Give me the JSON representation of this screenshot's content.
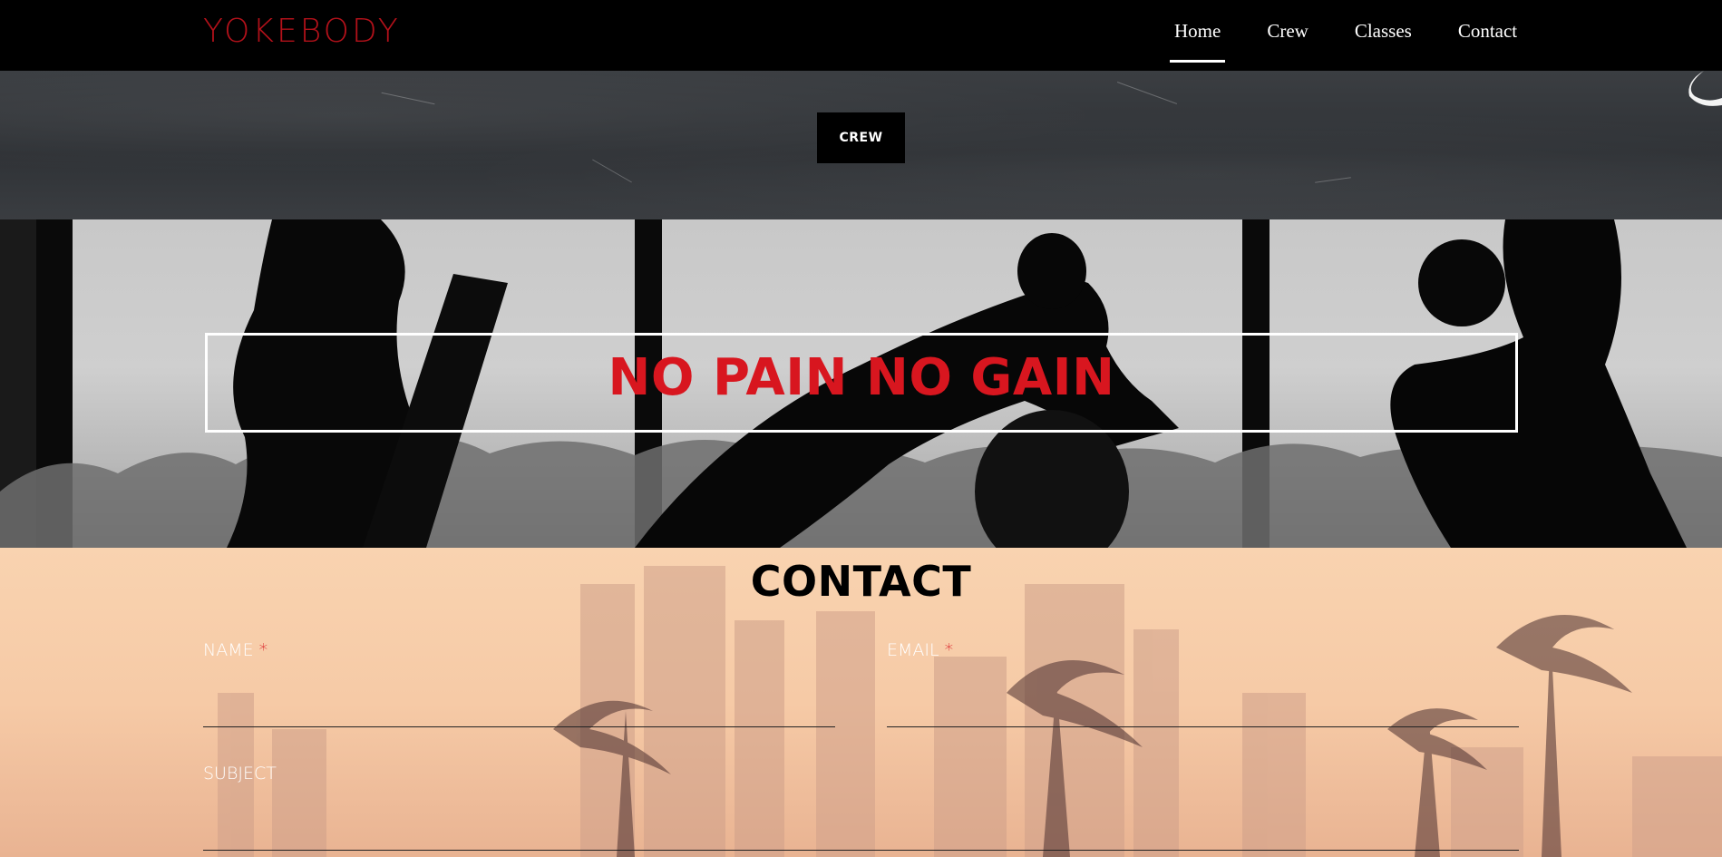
{
  "nav": {
    "logo": "YOKEBODY",
    "links": [
      {
        "label": "Home",
        "active": true
      },
      {
        "label": "Crew",
        "active": false
      },
      {
        "label": "Classes",
        "active": false
      },
      {
        "label": "Contact",
        "active": false
      }
    ]
  },
  "crew_section": {
    "button_label": "CREW"
  },
  "hero": {
    "slogan": "NO PAIN NO GAIN"
  },
  "contact": {
    "title": "CONTACT",
    "fields": {
      "name": {
        "label": "NAME",
        "required_mark": "*",
        "value": ""
      },
      "email": {
        "label": "EMAIL",
        "required_mark": "*",
        "value": ""
      },
      "subject": {
        "label": "SUBJECT",
        "value": ""
      }
    }
  },
  "colors": {
    "logo": "#b3111a",
    "slogan": "#d8161f",
    "required": "#d8161f",
    "nav_bg": "#000000",
    "contact_bg": "#f6caa6"
  }
}
